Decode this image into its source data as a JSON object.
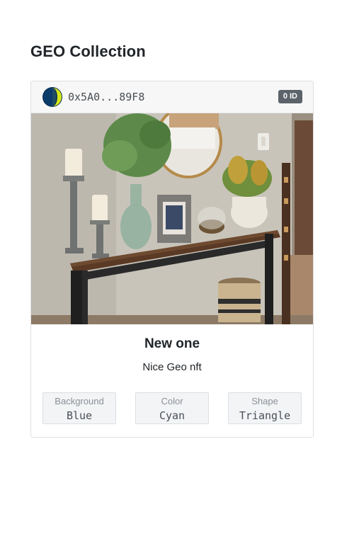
{
  "page": {
    "title": "GEO Collection"
  },
  "card": {
    "owner_address": "0x5A0...89F8",
    "id_badge": "0 ID",
    "avatar_colors": {
      "background": "#0d2b4e",
      "accent": "#d4ea1a"
    },
    "image_icon": "nft-artwork-photo",
    "name": "New one",
    "description": "Nice Geo nft",
    "attributes": [
      {
        "trait": "Background",
        "value": "Blue"
      },
      {
        "trait": "Color",
        "value": "Cyan"
      },
      {
        "trait": "Shape",
        "value": "Triangle"
      }
    ]
  },
  "colors": {
    "header_bg": "#f7f7f7",
    "badge_bg": "#5c636a",
    "attribute_bg": "#f3f4f6"
  }
}
